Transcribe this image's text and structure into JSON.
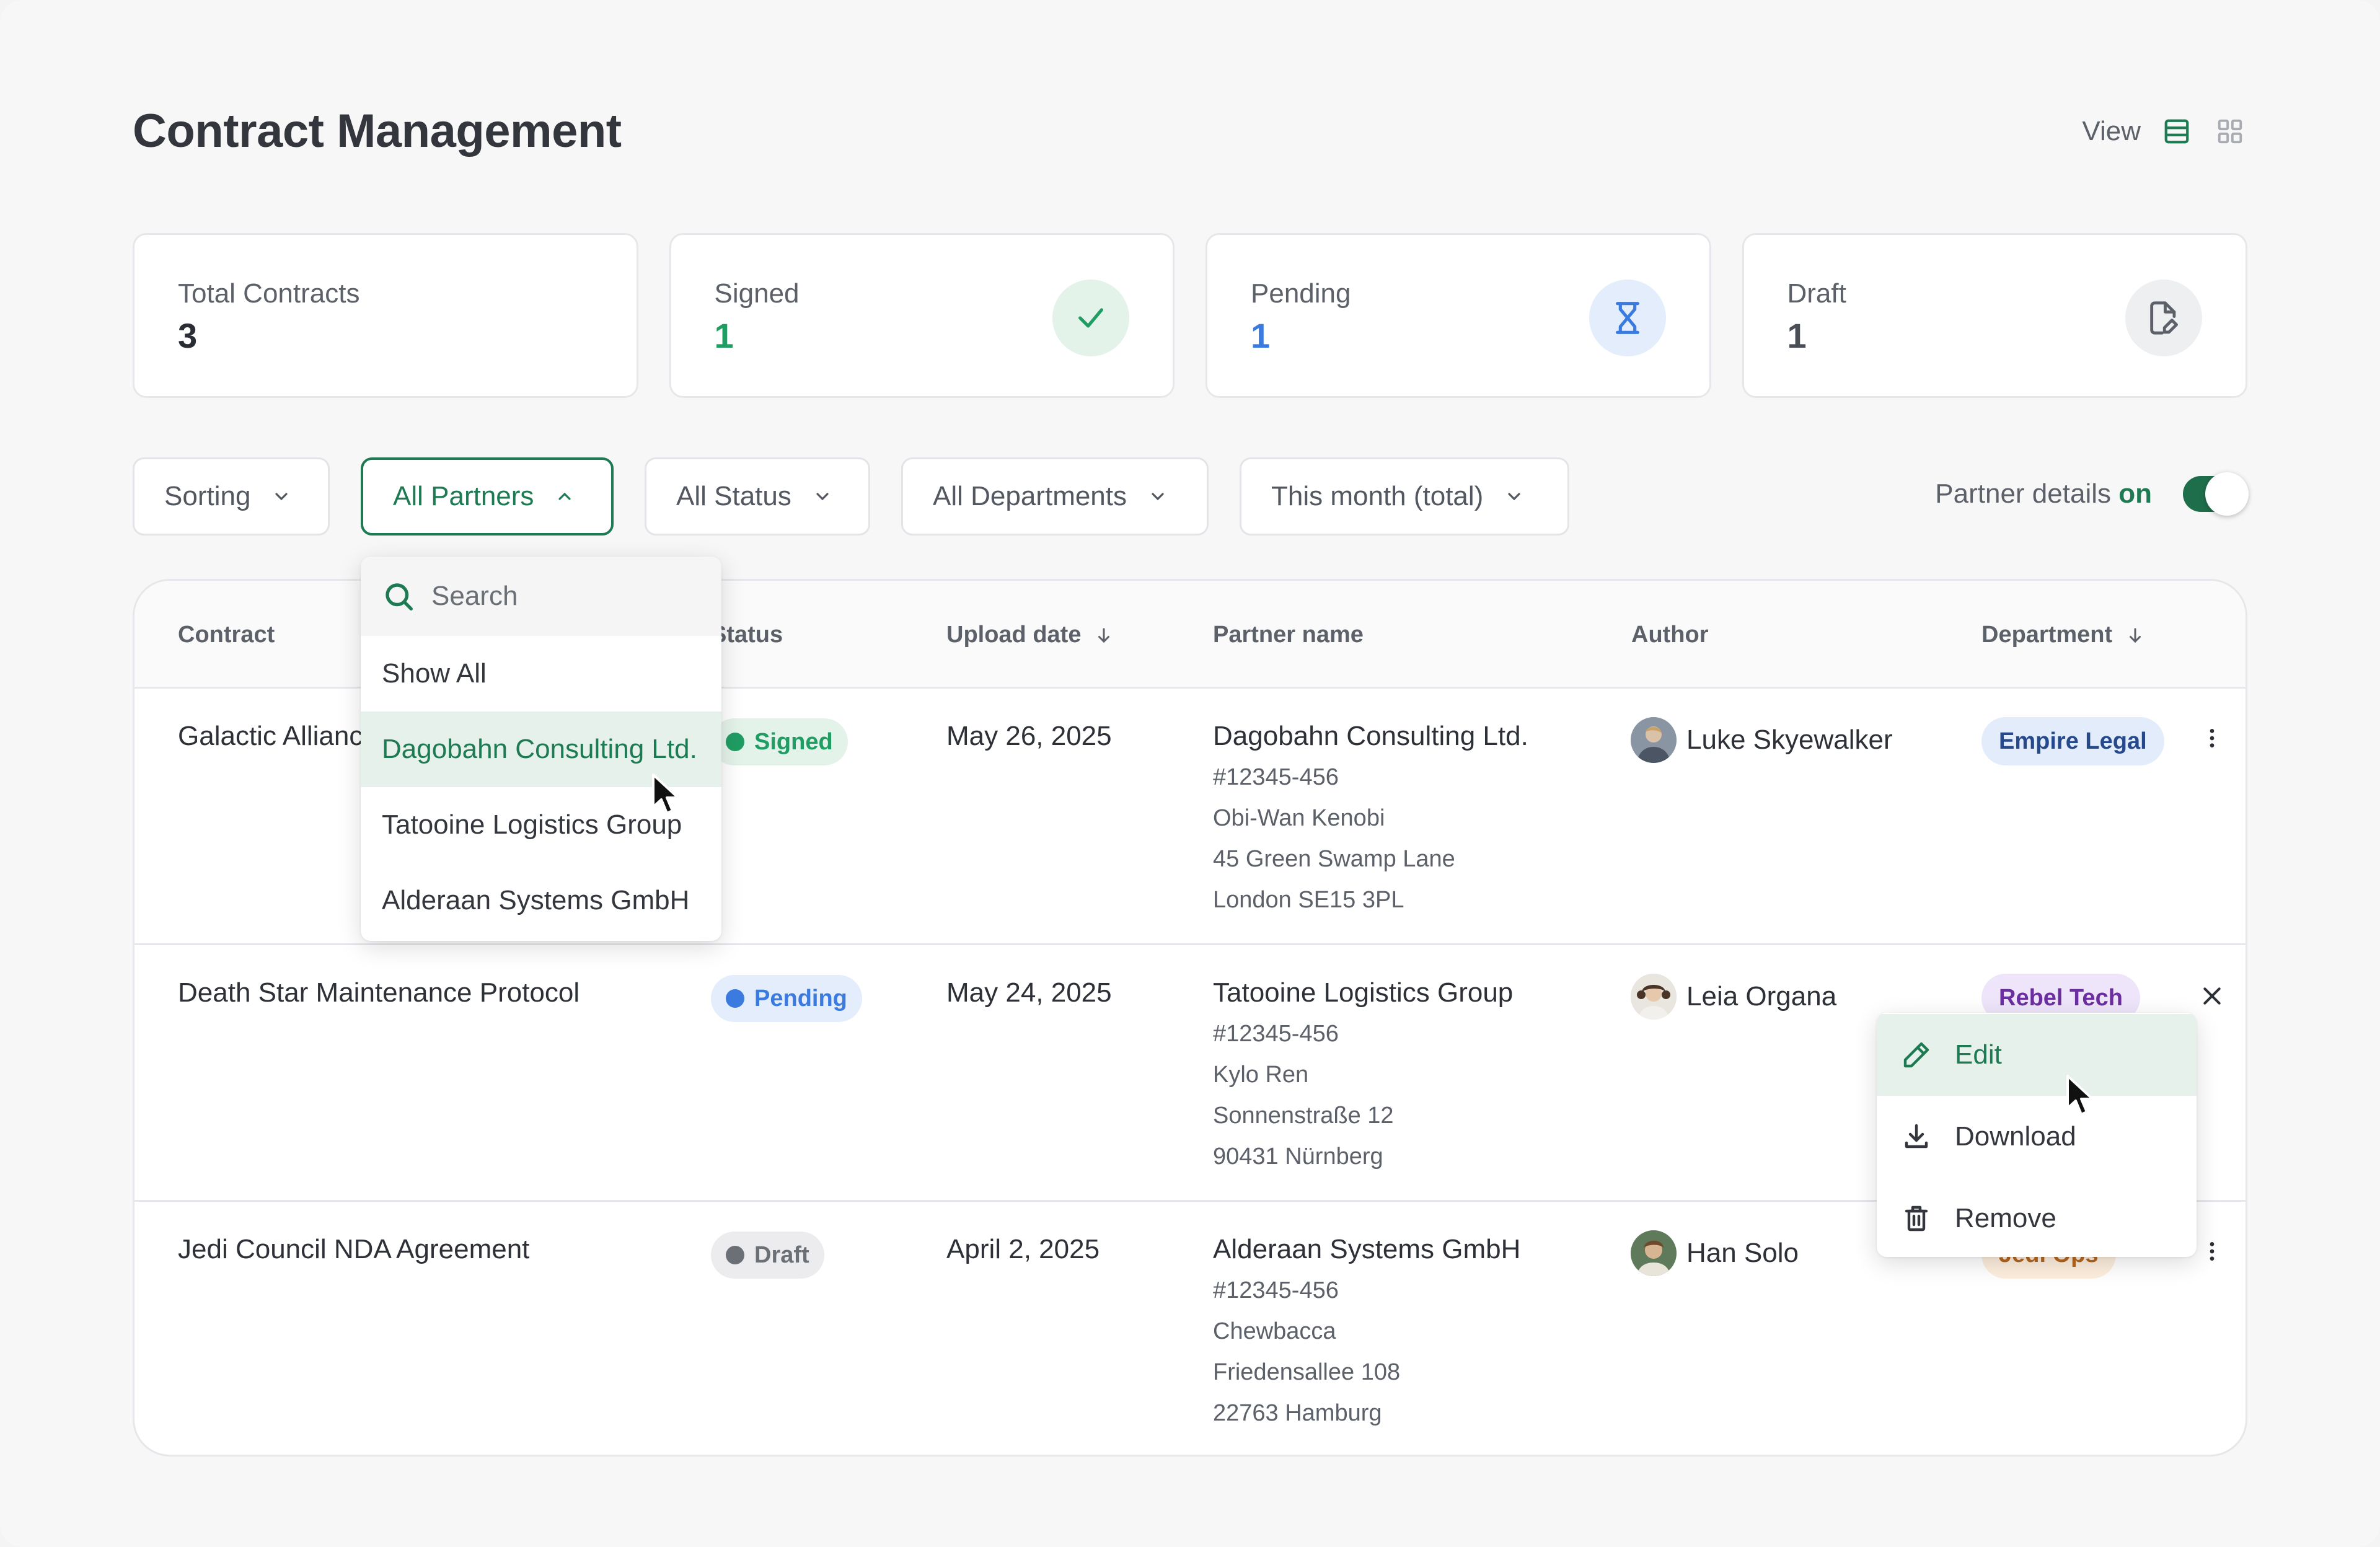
{
  "header": {
    "title": "Contract Management",
    "view_label": "View",
    "view_modes": [
      "list-view-icon",
      "grid-view-icon"
    ]
  },
  "stats": [
    {
      "label": "Total Contracts",
      "value": "3",
      "color": "#2a2d33",
      "icon": ""
    },
    {
      "label": "Signed",
      "value": "1",
      "color": "#1f9d63",
      "icon": "check-icon"
    },
    {
      "label": "Pending",
      "value": "1",
      "color": "#3b7be0",
      "icon": "hourglass-icon"
    },
    {
      "label": "Draft",
      "value": "1",
      "color": "#4a4e56",
      "icon": "file-edit-icon"
    }
  ],
  "filters": {
    "sorting": "Sorting",
    "partners": "All Partners",
    "status": "All Status",
    "departments": "All Departments",
    "period": "This month (total)"
  },
  "partner_details": {
    "label": "Partner details",
    "state": "on"
  },
  "table": {
    "headers": {
      "contract": "Contract",
      "status": "Status",
      "upload_date": "Upload date",
      "partner_name": "Partner name",
      "author": "Author",
      "department": "Department"
    },
    "rows": [
      {
        "contract": "Galactic Alliance",
        "status": "Signed",
        "upload_date": "May 26, 2025",
        "partner_name": "Dagobahn Consulting Ltd.",
        "partner_id": "#12345-456",
        "contact": "Obi-Wan Kenobi",
        "street": "45 Green Swamp Lane",
        "city": "London SE15 3PL",
        "author": "Luke Skyewalker",
        "department": "Empire Legal"
      },
      {
        "contract": "Death Star Maintenance Protocol",
        "status": "Pending",
        "upload_date": "May 24, 2025",
        "partner_name": "Tatooine Logistics Group",
        "partner_id": "#12345-456",
        "contact": "Kylo Ren",
        "street": "Sonnenstraße 12",
        "city": "90431 Nürnberg",
        "author": "Leia Organa",
        "department": "Rebel Tech"
      },
      {
        "contract": "Jedi Council NDA Agreement",
        "status": "Draft",
        "upload_date": "April 2, 2025",
        "partner_name": "Alderaan Systems GmbH",
        "partner_id": "#12345-456",
        "contact": "Chewbacca",
        "street": "Friedensallee 108",
        "city": "22763 Hamburg",
        "author": "Han Solo",
        "department": "Jedi Ops"
      }
    ]
  },
  "partner_dropdown": {
    "search_placeholder": "Search",
    "options": [
      "Show All",
      "Dagobahn Consulting Ltd.",
      "Tatooine Logistics Group",
      "Alderaan Systems GmbH"
    ],
    "highlighted": "Dagobahn Consulting Ltd."
  },
  "row_menu": {
    "items": [
      "Edit",
      "Download",
      "Remove"
    ],
    "highlighted": "Edit"
  },
  "colors": {
    "accent": "#1e7a52",
    "signed": "#1f9d63",
    "pending": "#3b7be0",
    "draft": "#6b6f76"
  }
}
